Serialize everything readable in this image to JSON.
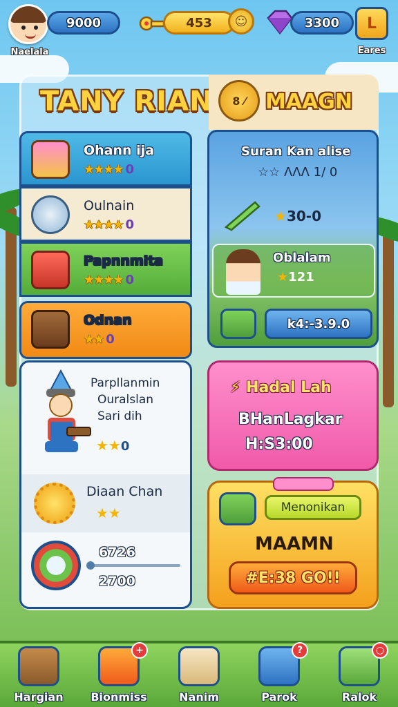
{
  "topbar": {
    "player_name": "Naelala",
    "currency_1": "9000",
    "currency_2": "453",
    "currency_3": "3300",
    "settings_label": "Eares",
    "settings_glyph": "L"
  },
  "header": {
    "title_left": "TANY RIAN",
    "title_right": "MAAGN",
    "helmet_glyph": "8 ⁄"
  },
  "left_list": [
    {
      "name": "Ohann ija",
      "stars": "★★★★",
      "num": "0",
      "color": "#35a8d9"
    },
    {
      "name": "Oulnain",
      "stars": "★★★★",
      "num": "0",
      "color": "#f5ead2"
    },
    {
      "name": "Papnnmita",
      "stars": "★★★★",
      "num": "0",
      "color": "#6cc24a"
    },
    {
      "name": "Odnan",
      "stars": "★★",
      "num": "0",
      "color": "#f7941d"
    }
  ],
  "worker_card": {
    "line1": "Parpllanmin",
    "line2": "Ouralslan",
    "line3": "Sari dih",
    "stars": "★★",
    "num": "0"
  },
  "gear_row": {
    "name": "Diaan Chan",
    "stars": "★★"
  },
  "shield_row": {
    "value_top": "6726",
    "value_bottom": "2700",
    "progress": 0.0
  },
  "right_panel": {
    "title": "Suran Kan alise",
    "stars_line": "☆☆ ΛΛΛ 1/ 0",
    "value": "30-0",
    "hero_name": "Oblalam",
    "hero_value": "121",
    "bar_value": "k4:-3.9.0"
  },
  "pink_card": {
    "title": "Hadal Lah",
    "subtitle": "BHanLagkar",
    "timer": "H:S3:00"
  },
  "yellow_card": {
    "tag": "Menonikan",
    "title": "MAAMN",
    "button": "#E:38 GO!!"
  },
  "nav": [
    {
      "label": "Hargian",
      "badge": ""
    },
    {
      "label": "Bionmiss",
      "badge": "+"
    },
    {
      "label": "Nanim",
      "badge": ""
    },
    {
      "label": "Parok",
      "badge": "?"
    },
    {
      "label": "Ralok",
      "badge": "○"
    }
  ]
}
